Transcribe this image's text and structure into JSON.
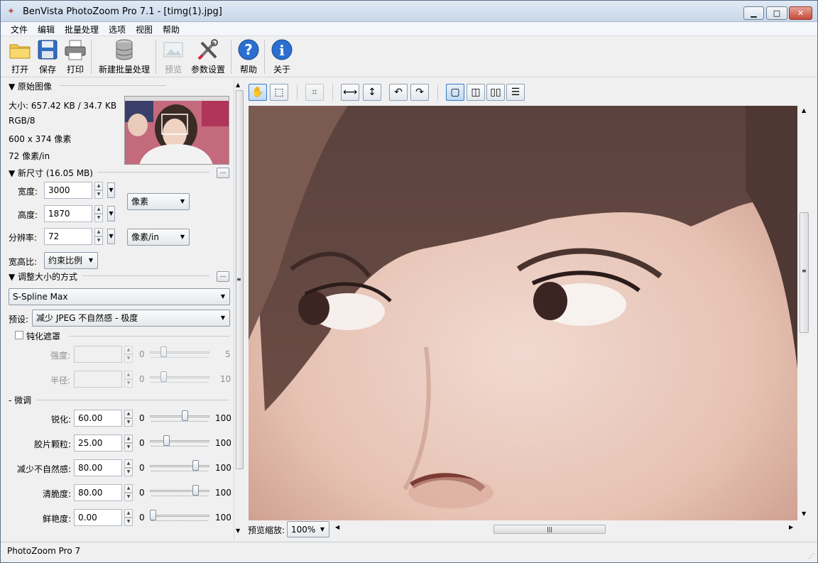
{
  "window": {
    "title": "BenVista PhotoZoom Pro 7.1 - [timg(1).jpg]"
  },
  "menu": [
    "文件",
    "编辑",
    "批量处理",
    "选项",
    "视图",
    "帮助"
  ],
  "toolbar": {
    "open": "打开",
    "save": "保存",
    "print": "打印",
    "new_batch": "新建批量处理",
    "preview": "预览",
    "settings": "参数设置",
    "help": "帮助",
    "about": "关于"
  },
  "original": {
    "header": "▼ 原始图像",
    "size": "大小: 657.42 KB / 34.7 KB",
    "mode": "RGB/8",
    "dimensions": "600 x 374 像素",
    "resolution": "72 像素/in"
  },
  "new_size": {
    "header": "▼ 新尺寸 (16.05 MB)",
    "width_label": "宽度:",
    "width_value": "3000",
    "height_label": "高度:",
    "height_value": "1870",
    "res_label": "分辨率:",
    "res_value": "72",
    "unit": "像素",
    "res_unit": "像素/in",
    "aspect_label": "宽高比:",
    "aspect_value": "约束比例"
  },
  "resize": {
    "header": "▼ 调整大小的方式",
    "method": "S-Spline Max",
    "preset_label": "预设:",
    "preset_value": "减少 JPEG 不自然感 - 极度"
  },
  "unsharp": {
    "header": "钝化遮罩",
    "strength_label": "强度:",
    "strength_min": "0",
    "strength_max": "5",
    "radius_label": "半径:",
    "radius_min": "0",
    "radius_max": "10"
  },
  "finetune": {
    "header": "微调",
    "rows": [
      {
        "label": "锐化:",
        "value": "60.00",
        "min": "0",
        "max": "100",
        "level": 0.6
      },
      {
        "label": "胶片颗粒:",
        "value": "25.00",
        "min": "0",
        "max": "100",
        "level": 0.25
      },
      {
        "label": "减少不自然感:",
        "value": "80.00",
        "min": "0",
        "max": "100",
        "level": 0.8
      },
      {
        "label": "清脆度:",
        "value": "80.00",
        "min": "0",
        "max": "100",
        "level": 0.8
      },
      {
        "label": "鲜艳度:",
        "value": "0.00",
        "min": "0",
        "max": "100",
        "level": 0.0
      }
    ]
  },
  "viewer": {
    "zoom_label": "预览缩放:",
    "zoom_value": "100%"
  },
  "status": {
    "text": "PhotoZoom Pro 7"
  }
}
